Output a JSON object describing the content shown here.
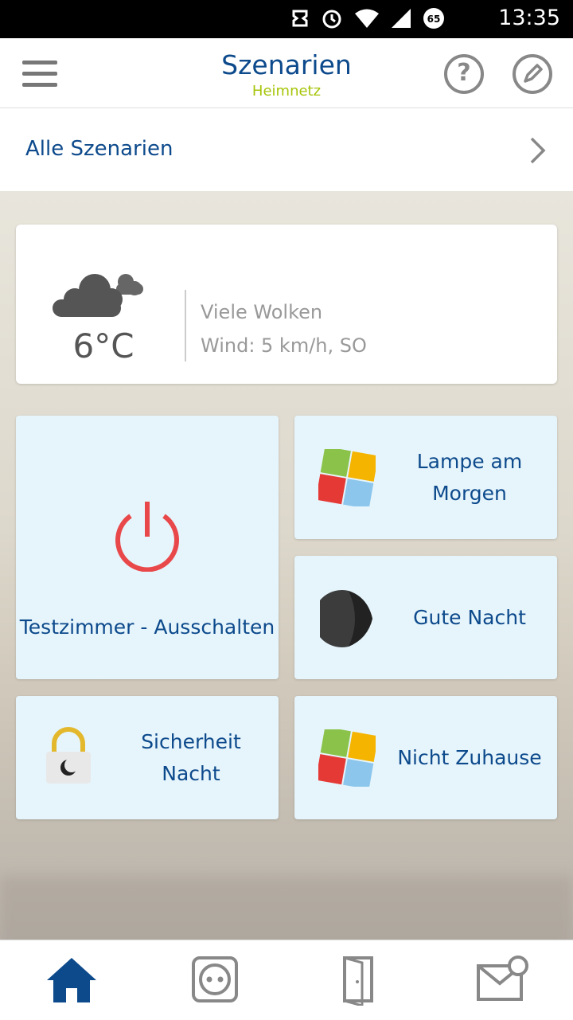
{
  "status_bar": {
    "battery_level": "65",
    "time": "13:35"
  },
  "header": {
    "title": "Szenarien",
    "subtitle": "Heimnetz",
    "help_label": "?"
  },
  "all_scenes": {
    "label": "Alle Szenarien"
  },
  "weather": {
    "temperature": "6°C",
    "description": "Viele Wolken",
    "wind": "Wind: 5 km/h, SO",
    "icon": "cloud-icon"
  },
  "tiles": [
    {
      "label": "Testzimmer - Ausschalten",
      "icon": "power-icon"
    },
    {
      "label_lines": [
        "Lampe am",
        "Morgen"
      ],
      "icon": "puzzle-icon"
    },
    {
      "label": "Gute Nacht",
      "icon": "moon-icon"
    },
    {
      "label_lines": [
        "Sicherheit",
        "Nacht"
      ],
      "icon": "lock-night-icon"
    },
    {
      "label": "Nicht Zuhause",
      "icon": "puzzle-icon"
    }
  ],
  "bottom_nav": {
    "items": [
      "home-icon",
      "socket-icon",
      "door-icon",
      "mail-icon"
    ],
    "active": "home-icon"
  },
  "colors": {
    "primary": "#0d4a8c",
    "accent": "#a6c50a",
    "tile_bg": "#e6f5fc",
    "power_red": "#e9484a"
  }
}
